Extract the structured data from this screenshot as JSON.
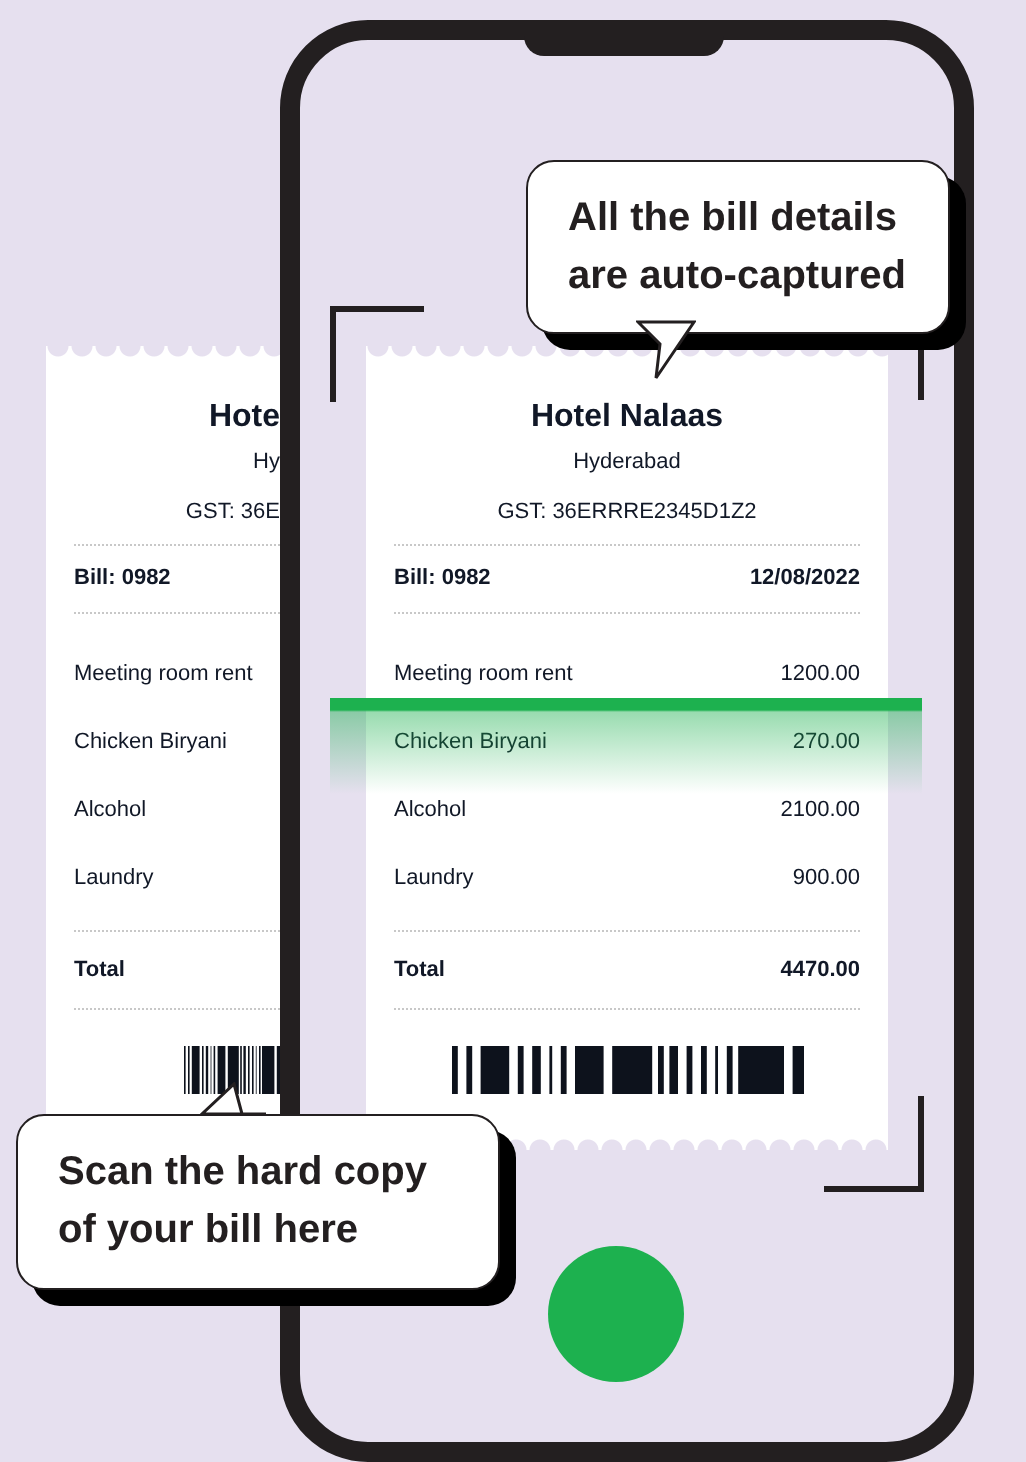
{
  "back_receipt": {
    "title": "Hote",
    "city": "Hy",
    "gst": "GST: 36E",
    "bill_no": "Bill: 0982",
    "items": [
      "Meeting room rent",
      "Chicken Biryani",
      "Alcohol",
      "Laundry"
    ],
    "total_label": "Total"
  },
  "receipt": {
    "title": "Hotel Nalaas",
    "city": "Hyderabad",
    "gst": "GST: 36ERRRE2345D1Z2",
    "bill_no": "Bill: 0982",
    "date": "12/08/2022",
    "items": [
      {
        "name": "Meeting room rent",
        "amount": "1200.00"
      },
      {
        "name": "Chicken Biryani",
        "amount": "270.00"
      },
      {
        "name": "Alcohol",
        "amount": "2100.00"
      },
      {
        "name": "Laundry",
        "amount": "900.00"
      }
    ],
    "total_label": "Total",
    "total": "4470.00"
  },
  "callouts": [
    {
      "text": "All the bill details are auto-captured",
      "kind": "down"
    },
    {
      "text": "Scan the hard copy of your bill here",
      "kind": "up"
    }
  ]
}
